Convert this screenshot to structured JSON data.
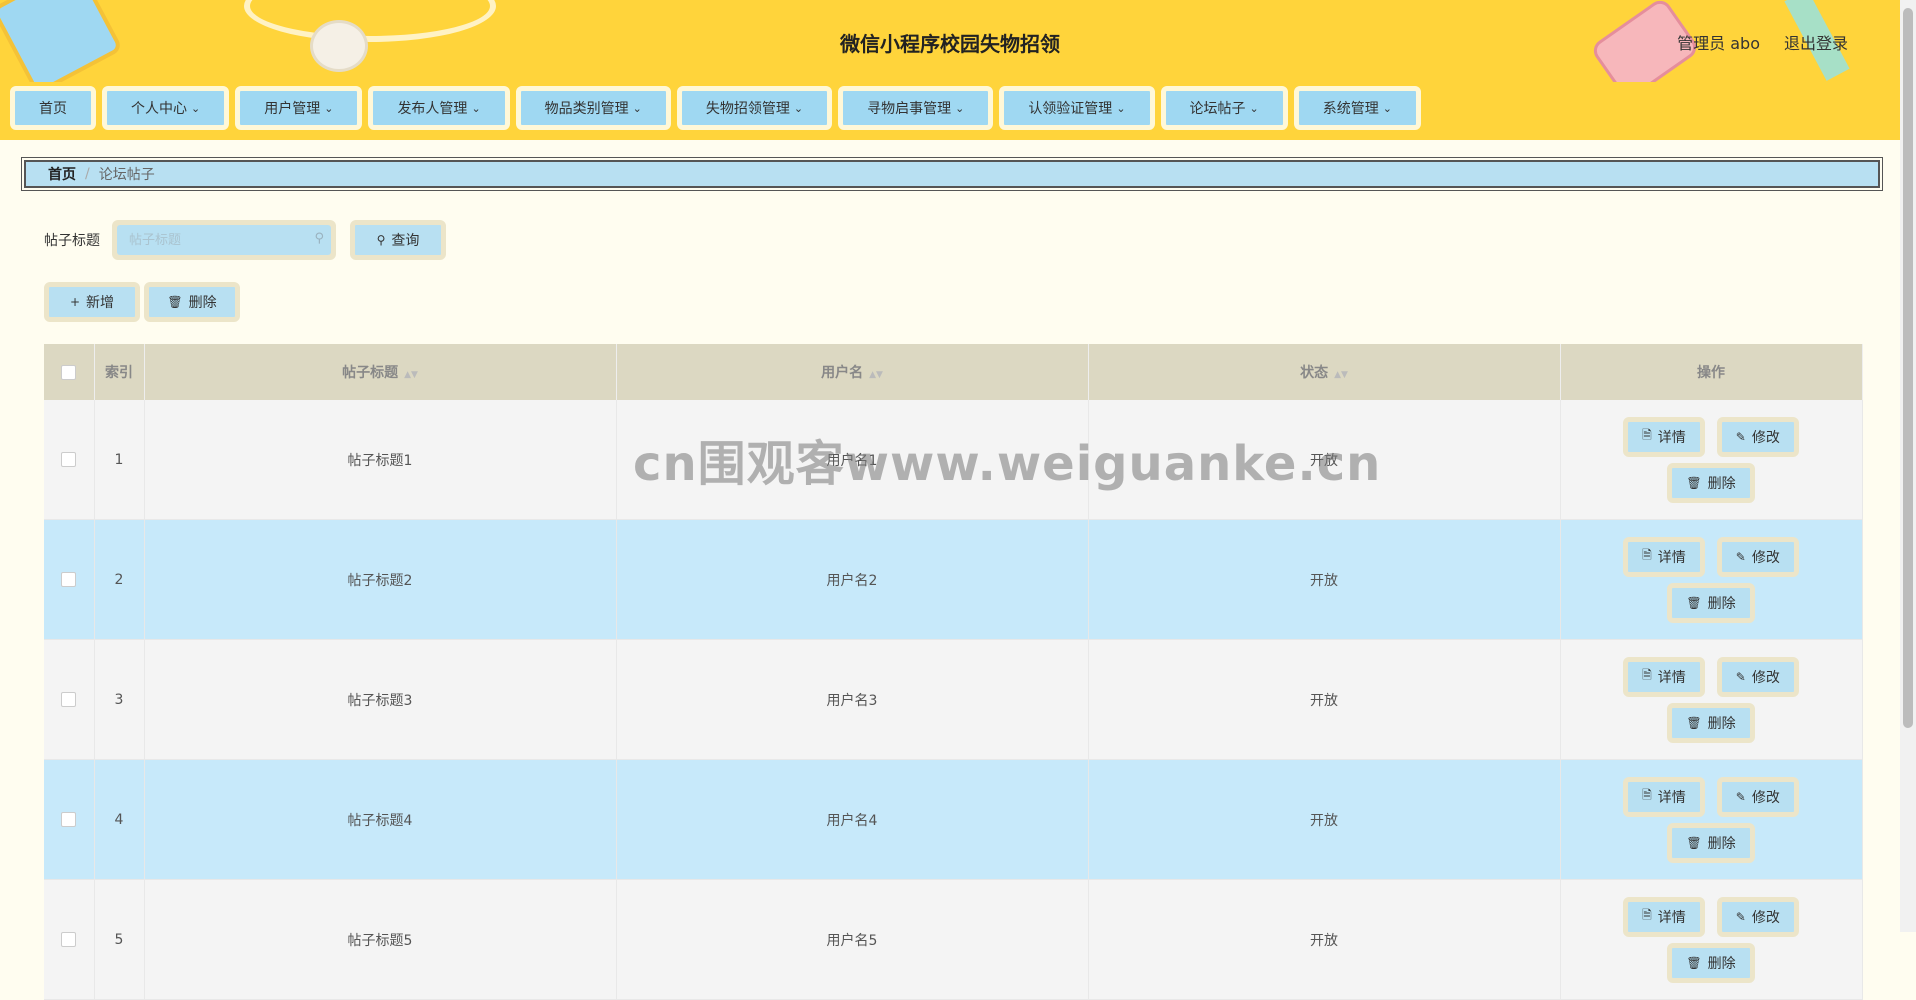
{
  "header": {
    "title": "微信小程序校园失物招领",
    "user_label": "管理员 abo",
    "logout_label": "退出登录"
  },
  "nav": [
    {
      "label": "首页",
      "has_dropdown": false
    },
    {
      "label": "个人中心",
      "has_dropdown": true
    },
    {
      "label": "用户管理",
      "has_dropdown": true
    },
    {
      "label": "发布人管理",
      "has_dropdown": true
    },
    {
      "label": "物品类别管理",
      "has_dropdown": true
    },
    {
      "label": "失物招领管理",
      "has_dropdown": true
    },
    {
      "label": "寻物启事管理",
      "has_dropdown": true
    },
    {
      "label": "认领验证管理",
      "has_dropdown": true
    },
    {
      "label": "论坛帖子",
      "has_dropdown": true
    },
    {
      "label": "系统管理",
      "has_dropdown": true
    }
  ],
  "breadcrumb": {
    "home": "首页",
    "separator": "/",
    "current": "论坛帖子"
  },
  "search": {
    "label": "帖子标题",
    "placeholder": "帖子标题",
    "value": "",
    "query_label": "查询"
  },
  "actions": {
    "add_label": "新增",
    "delete_label": "删除"
  },
  "table": {
    "headers": {
      "index": "索引",
      "title": "帖子标题",
      "username": "用户名",
      "status": "状态",
      "ops": "操作"
    },
    "rows": [
      {
        "index": "1",
        "title": "帖子标题1",
        "username": "用户名1",
        "status": "开放"
      },
      {
        "index": "2",
        "title": "帖子标题2",
        "username": "用户名2",
        "status": "开放"
      },
      {
        "index": "3",
        "title": "帖子标题3",
        "username": "用户名3",
        "status": "开放"
      },
      {
        "index": "4",
        "title": "帖子标题4",
        "username": "用户名4",
        "status": "开放"
      },
      {
        "index": "5",
        "title": "帖子标题5",
        "username": "用户名5",
        "status": "开放"
      }
    ],
    "op_labels": {
      "detail": "详情",
      "edit": "修改",
      "delete": "删除"
    }
  },
  "watermark": "cn围观客www.weiguanke.cn",
  "colors": {
    "header_bg": "#ffd43b",
    "accent_blue": "#b8e0f2",
    "row_highlight": "#c7e9fa",
    "page_bg": "#fffdf0"
  }
}
